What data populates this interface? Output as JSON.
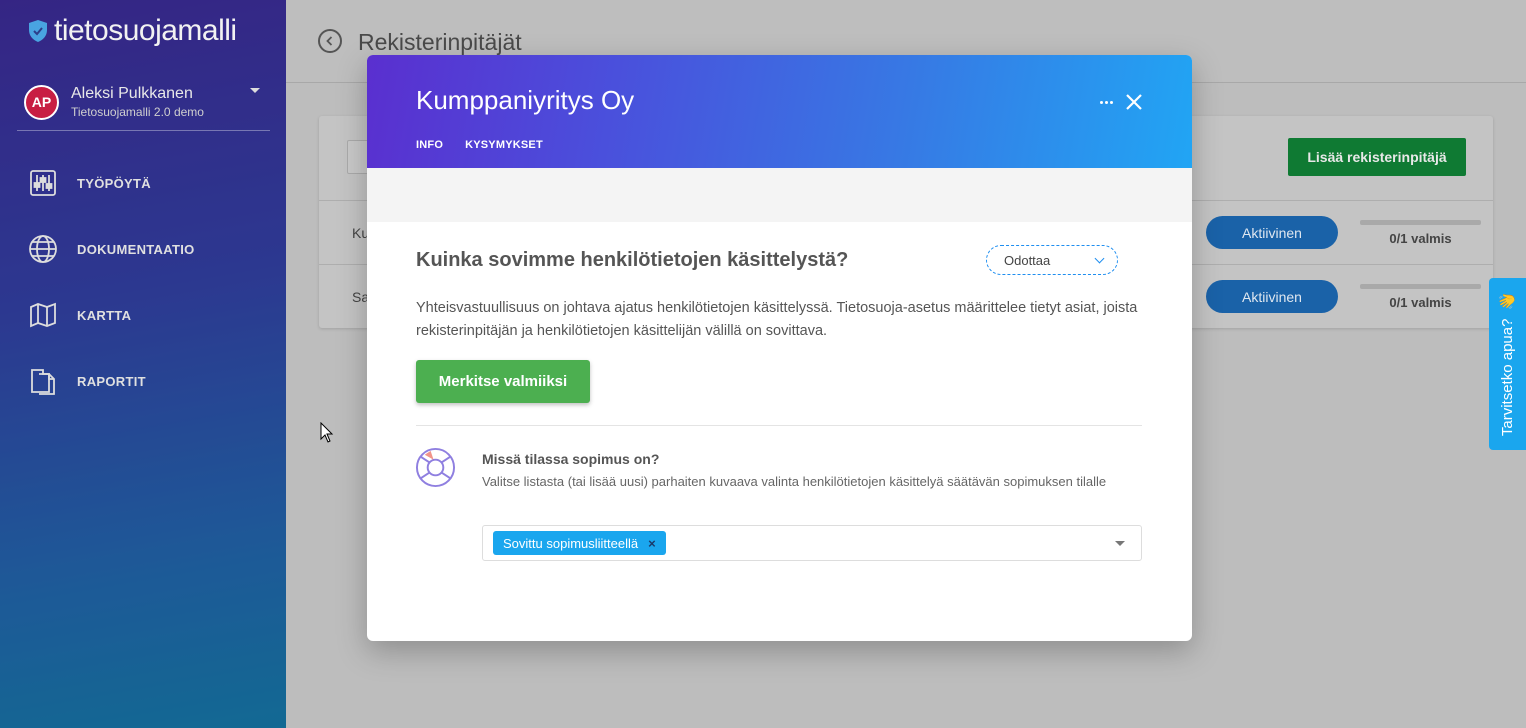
{
  "app": {
    "logo_text": "tietosuojamalli"
  },
  "user": {
    "initials": "AP",
    "name": "Aleksi Pulkkanen",
    "org": "Tietosuojamalli 2.0 demo"
  },
  "sidebar": {
    "items": [
      {
        "label": "TYÖPÖYTÄ",
        "icon": "sliders-icon"
      },
      {
        "label": "DOKUMENTAATIO",
        "icon": "globe-icon"
      },
      {
        "label": "KARTTA",
        "icon": "map-icon"
      },
      {
        "label": "RAPORTIT",
        "icon": "documents-icon"
      }
    ]
  },
  "page": {
    "title": "Rekisterinpitäjät",
    "add_button": "Lisää rekisterinpitäjä"
  },
  "rows": [
    {
      "name": "Ku",
      "status": "Aktiivinen",
      "progress": "0/1 valmis",
      "progress_fraction": 0
    },
    {
      "name": "Sa",
      "status": "Aktiivinen",
      "progress": "0/1 valmis",
      "progress_fraction": 0
    }
  ],
  "help": {
    "label": "Tarvitsetko apua?",
    "emoji": "👋"
  },
  "modal": {
    "title": "Kumppaniyritys Oy",
    "tabs": [
      "INFO",
      "KYSYMYKSET"
    ],
    "question_title": "Kuinka sovimme henkilötietojen käsittelystä?",
    "status": "Odottaa",
    "description": "Yhteisvastuullisuus on johtava ajatus henkilötietojen käsittelyssä. Tietosuoja-asetus määrittelee tietyt asiat, joista rekisterinpitäjän ja henkilötietojen käsittelijän välillä on sovittava.",
    "done_button": "Merkitse valmiiksi",
    "sub_question": {
      "title": "Missä tilassa sopimus on?",
      "description": "Valitse listasta (tai lisää uusi) parhaiten kuvaava valinta henkilötietojen käsittelyä säätävän sopimuksen tilalle",
      "selected": [
        "Sovittu sopimusliitteellä"
      ],
      "remove_symbol": "×"
    }
  },
  "colors": {
    "accent_green": "#4caf50",
    "accent_blue": "#1aa6ee",
    "header_gradient_start": "#5a2fcf",
    "header_gradient_end": "#21a5f4",
    "avatar": "#c81e43"
  }
}
